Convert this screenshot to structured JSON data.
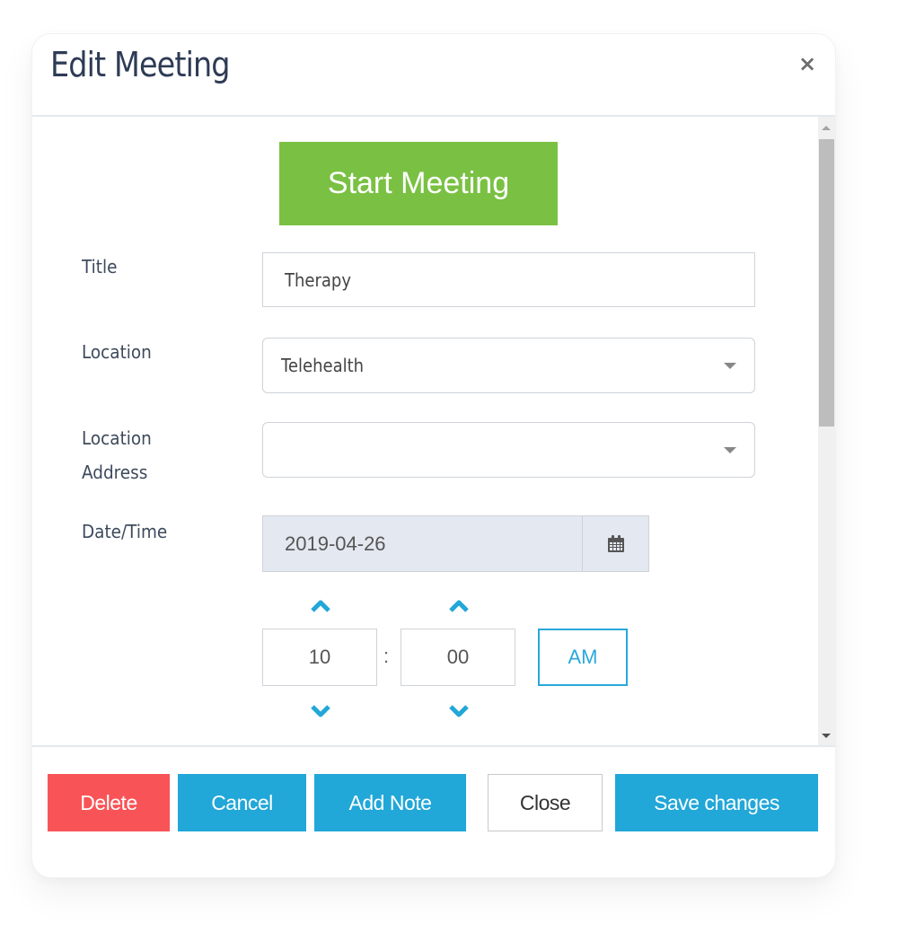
{
  "modal": {
    "title": "Edit Meeting",
    "close_icon": "times-icon"
  },
  "body": {
    "start_meeting_label": "Start Meeting",
    "fields": {
      "title": {
        "label": "Title",
        "value": "Therapy"
      },
      "location": {
        "label": "Location",
        "value": "Telehealth"
      },
      "location_address": {
        "label_line1": "Location",
        "label_line2": "Address",
        "value": ""
      },
      "date_time": {
        "label": "Date/Time",
        "date": "2019-04-26",
        "calendar_icon": "calendar-icon"
      }
    },
    "time": {
      "hour": "10",
      "separator": ":",
      "minute": "00",
      "meridian": "AM",
      "up_icon": "chevron-up-icon",
      "down_icon": "chevron-down-icon"
    }
  },
  "footer": {
    "delete_label": "Delete",
    "cancel_label": "Cancel",
    "add_note_label": "Add Note",
    "close_label": "Close",
    "save_label": "Save changes"
  },
  "colors": {
    "start_green": "#7ac143",
    "primary_blue": "#21a7d8",
    "danger_red": "#f85457",
    "title_navy": "#2e3b55"
  }
}
